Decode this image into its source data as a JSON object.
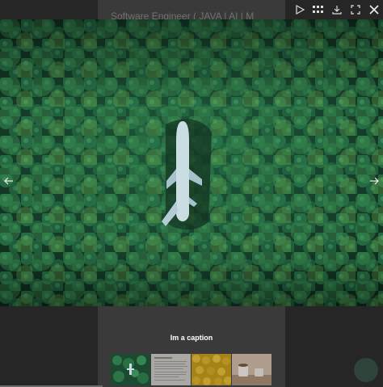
{
  "background_page": {
    "heading": "Software Engineer ( JAVA | AI | M"
  },
  "toolbar": {
    "play_icon": "play-icon",
    "thumbnails_icon": "grid-icon",
    "download_icon": "download-icon",
    "fullscreen_icon": "fullscreen-icon",
    "close_icon": "close-icon"
  },
  "image": {
    "subject": "airplane in forest"
  },
  "caption": "Im a caption",
  "thumbnails": [
    {
      "name": "forest-airplane"
    },
    {
      "name": "document-page"
    },
    {
      "name": "yellow-flowers"
    },
    {
      "name": "coffee-cups"
    }
  ],
  "colors": {
    "overlay": "#262626",
    "accent": "#2f6a4e"
  }
}
